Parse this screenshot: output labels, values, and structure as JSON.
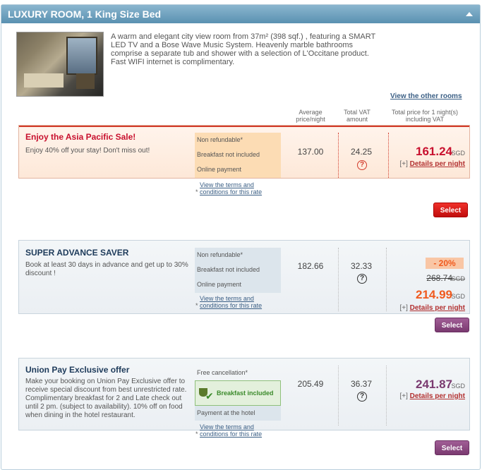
{
  "room": {
    "title": "LUXURY ROOM, 1 King Size Bed",
    "description": "A warm and elegant city view room from 37m² (398 sqf.) , featuring a SMART LED TV and a Bose Wave Music System. Heavenly marble bathrooms comprise a separate tub and shower with a selection of L'Occitane product. Fast WIFI internet is complimentary.",
    "view_other_link": "View the other rooms"
  },
  "columns": {
    "avg": [
      "Average",
      "price/night"
    ],
    "vat": [
      "Total VAT",
      "amount"
    ],
    "total": [
      "Total price for 1 night(s)",
      "including VAT"
    ]
  },
  "rates": [
    {
      "name": "Enjoy the Asia Pacific Sale!",
      "description": "Enjoy 40% off your stay! Don't miss out!",
      "conditions": [
        "Non refundable*",
        "Breakfast not included",
        "Online payment"
      ],
      "terms_prefix": "*",
      "terms_link": "View the terms and conditions for this rate",
      "avg_price": "137.00",
      "vat": "24.25",
      "help": "?",
      "total": "161.24",
      "currency": "SGD",
      "details_prefix": "[+]",
      "details_link": "Details per night",
      "button": "Select"
    },
    {
      "name": "SUPER ADVANCE SAVER",
      "description": "Book at least 30 days in advance and get up to 30% discount !",
      "conditions": [
        "Non refundable*",
        "Breakfast not included",
        "Online payment"
      ],
      "terms_prefix": "*",
      "terms_link": "View the terms and conditions for this rate",
      "avg_price": "182.66",
      "vat": "32.33",
      "help": "?",
      "discount": "- 20%",
      "old_total": "268.74",
      "total": "214.99",
      "currency": "SGD",
      "details_prefix": "[+]",
      "details_link": "Details per night",
      "button": "Select"
    },
    {
      "name": "Union Pay Exclusive offer",
      "description": "Make your booking on Union Pay Exclusive offer to receive special discount from best unrestricted rate. Complimentary breakfast for 2 and Late check out until 2 pm. (subject to availability). 10% off on food when dining in the hotel restaurant.",
      "conditions": [
        "Free cancellation*",
        "Breakfast included",
        "Payment at the hotel"
      ],
      "terms_prefix": "*",
      "terms_link": "View the terms and conditions for this rate",
      "avg_price": "205.49",
      "vat": "36.37",
      "help": "?",
      "total": "241.87",
      "currency": "SGD",
      "details_prefix": "[+]",
      "details_link": "Details per night",
      "button": "Select"
    }
  ],
  "colors": {
    "header": "#6ea3c2",
    "sale_price": "#c8102e",
    "saver_price": "#f05a1e",
    "union_price": "#7a3a70",
    "select_red": "#d01515",
    "select_purple": "#8a4a80"
  }
}
